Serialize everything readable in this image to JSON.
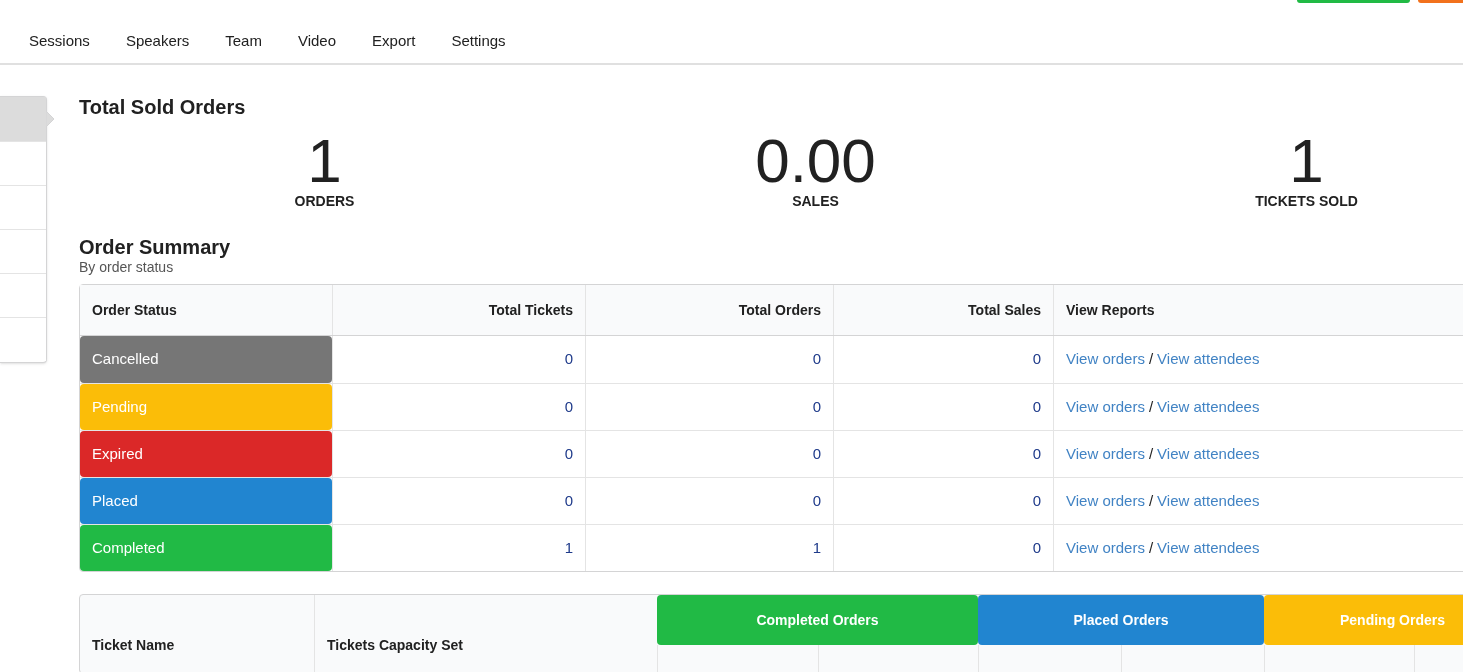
{
  "top_buttons": [
    {
      "color": "#21ba45"
    },
    {
      "color": "#f2711c"
    }
  ],
  "nav": {
    "items": [
      {
        "label": "Sessions"
      },
      {
        "label": "Speakers"
      },
      {
        "label": "Team"
      },
      {
        "label": "Video"
      },
      {
        "label": "Export"
      },
      {
        "label": "Settings"
      }
    ]
  },
  "sidebar": {
    "items": [
      {
        "selected": true
      },
      {
        "selected": false
      },
      {
        "selected": false
      },
      {
        "selected": false
      },
      {
        "selected": false
      },
      {
        "selected": false
      }
    ]
  },
  "total_sold": {
    "title": "Total Sold Orders",
    "stats": [
      {
        "value": "1",
        "label": "ORDERS"
      },
      {
        "value": "0.00",
        "label": "SALES"
      },
      {
        "value": "1",
        "label": "TICKETS SOLD"
      }
    ]
  },
  "order_summary": {
    "title": "Order Summary",
    "subtitle": "By order status",
    "columns": [
      "Order Status",
      "Total Tickets",
      "Total Orders",
      "Total Sales",
      "View Reports"
    ],
    "rows": [
      {
        "status": "Cancelled",
        "color": "#767676",
        "tickets": "0",
        "orders": "0",
        "sales": "0",
        "link_orders": "View orders",
        "separator": "/",
        "link_attendees": "View attendees"
      },
      {
        "status": "Pending",
        "color": "#fbbd08",
        "tickets": "0",
        "orders": "0",
        "sales": "0",
        "link_orders": "View orders",
        "separator": "/",
        "link_attendees": "View attendees"
      },
      {
        "status": "Expired",
        "color": "#db2828",
        "tickets": "0",
        "orders": "0",
        "sales": "0",
        "link_orders": "View orders",
        "separator": "/",
        "link_attendees": "View attendees"
      },
      {
        "status": "Placed",
        "color": "#2185d0",
        "tickets": "0",
        "orders": "0",
        "sales": "0",
        "link_orders": "View orders",
        "separator": "/",
        "link_attendees": "View attendees"
      },
      {
        "status": "Completed",
        "color": "#21ba45",
        "tickets": "1",
        "orders": "1",
        "sales": "0",
        "link_orders": "View orders",
        "separator": "/",
        "link_attendees": "View attendees"
      }
    ]
  },
  "tickets_table": {
    "columns": [
      "Ticket Name",
      "Tickets Capacity Set"
    ],
    "groups": [
      {
        "label": "Completed Orders",
        "color": "#21ba45"
      },
      {
        "label": "Placed Orders",
        "color": "#2185d0"
      },
      {
        "label": "Pending Orders",
        "color": "#fbbd08"
      }
    ]
  }
}
